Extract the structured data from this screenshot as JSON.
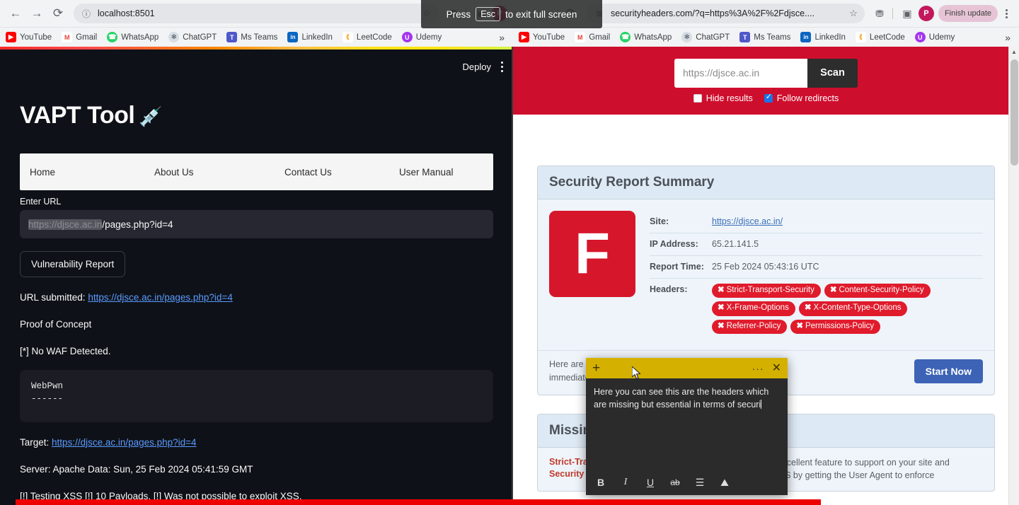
{
  "browser_left": {
    "back_icon": "arrow-left",
    "forward_icon": "arrow-right",
    "reload_icon": "reload",
    "site_info_icon": "info-circle",
    "url": "localhost:8501",
    "star_icon": "star-outline",
    "extensions_icon": "puzzle",
    "sidepanel_icon": "side-panel",
    "profile_initial": "P"
  },
  "browser_right": {
    "back_icon": "arrow-left",
    "forward_icon": "arrow-right",
    "reload_icon": "reload",
    "site_info_icon": "tune",
    "url": "securityheaders.com/?q=https%3A%2F%2Fdjsce....",
    "star_icon": "star-outline",
    "extensions_icon": "puzzle",
    "sidepanel_icon": "side-panel",
    "profile_initial": "P",
    "finish_update_label": "Finish update"
  },
  "bookmarks": [
    {
      "label": "YouTube",
      "icon": "youtube-icon",
      "color": "#ff0000",
      "glyph": "▶"
    },
    {
      "label": "Gmail",
      "icon": "gmail-icon",
      "color": "#ffffff",
      "glyph": "M"
    },
    {
      "label": "WhatsApp",
      "icon": "whatsapp-icon",
      "color": "#25d366",
      "glyph": "✆"
    },
    {
      "label": "ChatGPT",
      "icon": "chatgpt-icon",
      "color": "#d7dde3",
      "glyph": "✻"
    },
    {
      "label": "Ms Teams",
      "icon": "msteams-icon",
      "color": "#5059c9",
      "glyph": "T"
    },
    {
      "label": "LinkedIn",
      "icon": "linkedin-icon",
      "color": "#0a66c2",
      "glyph": "in"
    },
    {
      "label": "LeetCode",
      "icon": "leetcode-icon",
      "color": "#ffffff",
      "glyph": "⬡"
    },
    {
      "label": "Udemy",
      "icon": "udemy-icon",
      "color": "#a435f0",
      "glyph": "U"
    }
  ],
  "bookmarks_overflow_icon": "chevron-double-right",
  "fullscreen_overlay": {
    "prefix": "Press",
    "key": "Esc",
    "suffix": "to exit full screen"
  },
  "vapt_app": {
    "deploy_label": "Deploy",
    "menu_icon": "kebab-menu-icon",
    "title": "VAPT Tool",
    "title_emoji": "💉",
    "tabs": [
      {
        "label": "Home"
      },
      {
        "label": "About Us"
      },
      {
        "label": "Contact Us"
      },
      {
        "label": "User Manual"
      }
    ],
    "url_field": {
      "label": "Enter URL",
      "selected_text": "https://djsce.ac.in",
      "rest_text": "/pages.php?id=4"
    },
    "report_button": "Vulnerability Report",
    "submitted_label": "URL submitted:",
    "submitted_url": "https://djsce.ac.in/pages.php?id=4",
    "poc_heading": "Proof of Concept",
    "waf_line": "[*] No WAF Detected.",
    "code_line1": "WebPwn",
    "code_line2": "------",
    "target_label": "Target:",
    "target_url": "https://djsce.ac.in/pages.php?id=4",
    "server_line": "Server: Apache Data: Sun, 25 Feb 2024 05:41:59 GMT",
    "xss_line": "[!] Testing XSS [!] 10 Payloads. [!] Was not possible to exploit XSS."
  },
  "security_headers": {
    "scan_url_placeholder": "https://djsce.ac.in",
    "scan_url_value": "",
    "scan_button": "Scan",
    "hide_results_label": "Hide results",
    "hide_results_checked": false,
    "follow_redirects_label": "Follow redirects",
    "follow_redirects_checked": true,
    "banner_color": "#ce0e2d",
    "summary": {
      "title": "Security Report Summary",
      "grade": "F",
      "grade_color": "#d6162a",
      "rows": [
        {
          "key": "Site:",
          "value": "https://djsce.ac.in/",
          "is_link": true
        },
        {
          "key": "IP Address:",
          "value": "65.21.141.5",
          "is_link": false
        },
        {
          "key": "Report Time:",
          "value": "25 Feb 2024 05:43:16 UTC",
          "is_link": false
        }
      ],
      "headers_key": "Headers:",
      "missing_chips": [
        "Strict-Transport-Security",
        "Content-Security-Policy",
        "X-Frame-Options",
        "X-Content-Type-Options",
        "Referrer-Policy",
        "Permissions-Policy"
      ],
      "chip_color": "#e01b2c",
      "advice_text": "Here are some things you could work on your security immediately:",
      "start_now_label": "Start Now"
    },
    "missing_headers": {
      "title": "Missing Headers",
      "rows": [
        {
          "name": "Strict-Transport-Security",
          "desc": "HTTP Strict Transport Security is an excellent feature to support on your site and strengthens your implementation of TLS by getting the User Agent to enforce"
        }
      ]
    }
  },
  "sticky_note": {
    "add_icon": "plus-icon",
    "menu_icon": "ellipsis-icon",
    "close_icon": "close-icon",
    "header_color": "#d4b100",
    "text": "Here you can see this are the headers which are missing but essential in terms of securi",
    "tools": [
      {
        "name": "bold-icon",
        "glyph": "B"
      },
      {
        "name": "italic-icon",
        "glyph": "I"
      },
      {
        "name": "underline-icon",
        "glyph": "U"
      },
      {
        "name": "strikethrough-icon",
        "glyph": "ab"
      },
      {
        "name": "bullet-list-icon",
        "glyph": "☰"
      },
      {
        "name": "image-icon",
        "glyph": "⛰"
      }
    ]
  },
  "scrollbar": {
    "up_icon": "chevron-up-icon",
    "down_icon": "chevron-down-icon"
  }
}
